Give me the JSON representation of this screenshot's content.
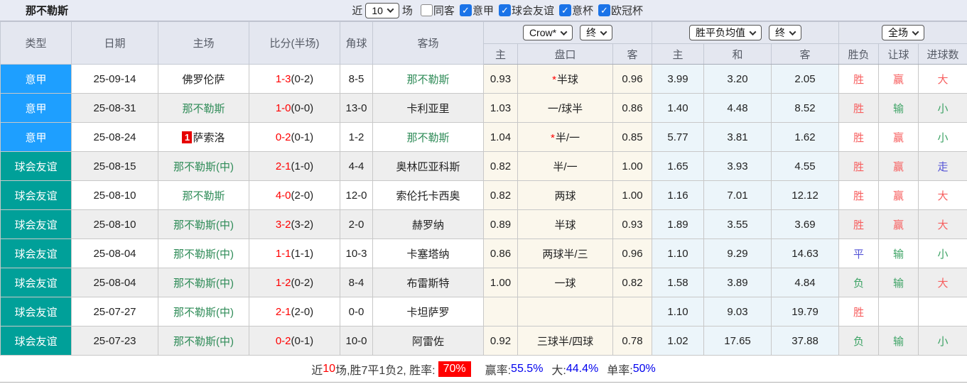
{
  "icons": {
    "check": "✓"
  },
  "top_bar": {
    "title": "那不勒斯",
    "recent_label": "近",
    "recent_count": "10",
    "matches_label": "场",
    "same_away_label": "同客",
    "filters": [
      {
        "label": "意甲",
        "checked": true
      },
      {
        "label": "球会友谊",
        "checked": true
      },
      {
        "label": "意杯",
        "checked": true
      },
      {
        "label": "欧冠杯",
        "checked": true
      }
    ]
  },
  "table": {
    "headers": {
      "type": "类型",
      "date": "日期",
      "home": "主场",
      "score": "比分(半场)",
      "corners": "角球",
      "away": "客场",
      "group_crow": {
        "bookmaker_select": "Crow*",
        "period_select": "终",
        "cols": [
          "主",
          "盘口",
          "客"
        ]
      },
      "group_mean": {
        "name_select": "胜平负均值",
        "period_select": "终",
        "cols": [
          "主",
          "和",
          "客"
        ]
      },
      "group_result": {
        "scope_select": "全场",
        "cols": [
          "胜负",
          "让球",
          "进球数"
        ]
      }
    },
    "rows": [
      {
        "type": "意甲",
        "league_class": "serie-a",
        "date": "25-09-14",
        "home": "佛罗伦萨",
        "home_color": "black",
        "home_rank": "",
        "score_ft": "1-3",
        "score_ht": "(0-2)",
        "corners": "8-5",
        "away": "那不勒斯",
        "away_color": "green",
        "crow_home": "0.93",
        "crow_ast": true,
        "crow_handicap": "半球",
        "crow_away": "0.96",
        "mean_home": "3.99",
        "mean_draw": "3.20",
        "mean_away": "2.05",
        "outcome": "胜",
        "outcome_color": "red",
        "handicap_result": "赢",
        "handicap_color": "red",
        "goals_result": "大",
        "goals_color": "red"
      },
      {
        "type": "意甲",
        "league_class": "serie-a",
        "date": "25-08-31",
        "home": "那不勒斯",
        "home_color": "green",
        "home_rank": "",
        "score_ft": "1-0",
        "score_ht": "(0-0)",
        "corners": "13-0",
        "away": "卡利亚里",
        "away_color": "black",
        "crow_home": "1.03",
        "crow_ast": false,
        "crow_handicap": "一/球半",
        "crow_away": "0.86",
        "mean_home": "1.40",
        "mean_draw": "4.48",
        "mean_away": "8.52",
        "outcome": "胜",
        "outcome_color": "red",
        "handicap_result": "输",
        "handicap_color": "green",
        "goals_result": "小",
        "goals_color": "green"
      },
      {
        "type": "意甲",
        "league_class": "serie-a",
        "date": "25-08-24",
        "home": "萨索洛",
        "home_color": "black",
        "home_rank": "1",
        "score_ft": "0-2",
        "score_ht": "(0-1)",
        "corners": "1-2",
        "away": "那不勒斯",
        "away_color": "green",
        "crow_home": "1.04",
        "crow_ast": true,
        "crow_handicap": "半/一",
        "crow_away": "0.85",
        "mean_home": "5.77",
        "mean_draw": "3.81",
        "mean_away": "1.62",
        "outcome": "胜",
        "outcome_color": "red",
        "handicap_result": "赢",
        "handicap_color": "red",
        "goals_result": "小",
        "goals_color": "green"
      },
      {
        "type": "球会友谊",
        "league_class": "friendly",
        "date": "25-08-15",
        "home": "那不勒斯(中)",
        "home_color": "green",
        "home_rank": "",
        "score_ft": "2-1",
        "score_ht": "(1-0)",
        "corners": "4-4",
        "away": "奥林匹亚科斯",
        "away_color": "black",
        "crow_home": "0.82",
        "crow_ast": false,
        "crow_handicap": "半/一",
        "crow_away": "1.00",
        "mean_home": "1.65",
        "mean_draw": "3.93",
        "mean_away": "4.55",
        "outcome": "胜",
        "outcome_color": "red",
        "handicap_result": "赢",
        "handicap_color": "red",
        "goals_result": "走",
        "goals_color": "blue"
      },
      {
        "type": "球会友谊",
        "league_class": "friendly",
        "date": "25-08-10",
        "home": "那不勒斯",
        "home_color": "green",
        "home_rank": "",
        "score_ft": "4-0",
        "score_ht": "(2-0)",
        "corners": "12-0",
        "away": "索伦托卡西奥",
        "away_color": "black",
        "crow_home": "0.82",
        "crow_ast": false,
        "crow_handicap": "两球",
        "crow_away": "1.00",
        "mean_home": "1.16",
        "mean_draw": "7.01",
        "mean_away": "12.12",
        "outcome": "胜",
        "outcome_color": "red",
        "handicap_result": "赢",
        "handicap_color": "red",
        "goals_result": "大",
        "goals_color": "red"
      },
      {
        "type": "球会友谊",
        "league_class": "friendly",
        "date": "25-08-10",
        "home": "那不勒斯(中)",
        "home_color": "green",
        "home_rank": "",
        "score_ft": "3-2",
        "score_ht": "(3-2)",
        "corners": "2-0",
        "away": "赫罗纳",
        "away_color": "black",
        "crow_home": "0.89",
        "crow_ast": false,
        "crow_handicap": "半球",
        "crow_away": "0.93",
        "mean_home": "1.89",
        "mean_draw": "3.55",
        "mean_away": "3.69",
        "outcome": "胜",
        "outcome_color": "red",
        "handicap_result": "赢",
        "handicap_color": "red",
        "goals_result": "大",
        "goals_color": "red"
      },
      {
        "type": "球会友谊",
        "league_class": "friendly",
        "date": "25-08-04",
        "home": "那不勒斯(中)",
        "home_color": "green",
        "home_rank": "",
        "score_ft": "1-1",
        "score_ht": "(1-1)",
        "corners": "10-3",
        "away": "卡塞塔纳",
        "away_color": "black",
        "crow_home": "0.86",
        "crow_ast": false,
        "crow_handicap": "两球半/三",
        "crow_away": "0.96",
        "mean_home": "1.10",
        "mean_draw": "9.29",
        "mean_away": "14.63",
        "outcome": "平",
        "outcome_color": "blue",
        "handicap_result": "输",
        "handicap_color": "green",
        "goals_result": "小",
        "goals_color": "green"
      },
      {
        "type": "球会友谊",
        "league_class": "friendly",
        "date": "25-08-04",
        "home": "那不勒斯(中)",
        "home_color": "green",
        "home_rank": "",
        "score_ft": "1-2",
        "score_ht": "(0-2)",
        "corners": "8-4",
        "away": "布雷斯特",
        "away_color": "black",
        "crow_home": "1.00",
        "crow_ast": false,
        "crow_handicap": "一球",
        "crow_away": "0.82",
        "mean_home": "1.58",
        "mean_draw": "3.89",
        "mean_away": "4.84",
        "outcome": "负",
        "outcome_color": "green",
        "handicap_result": "输",
        "handicap_color": "green",
        "goals_result": "大",
        "goals_color": "red"
      },
      {
        "type": "球会友谊",
        "league_class": "friendly",
        "date": "25-07-27",
        "home": "那不勒斯(中)",
        "home_color": "green",
        "home_rank": "",
        "score_ft": "2-1",
        "score_ht": "(2-0)",
        "corners": "0-0",
        "away": "卡坦萨罗",
        "away_color": "black",
        "crow_home": "",
        "crow_ast": false,
        "crow_handicap": "",
        "crow_away": "",
        "mean_home": "1.10",
        "mean_draw": "9.03",
        "mean_away": "19.79",
        "outcome": "胜",
        "outcome_color": "red",
        "handicap_result": "",
        "handicap_color": "none",
        "goals_result": "",
        "goals_color": "none"
      },
      {
        "type": "球会友谊",
        "league_class": "friendly",
        "date": "25-07-23",
        "home": "那不勒斯(中)",
        "home_color": "green",
        "home_rank": "",
        "score_ft": "0-2",
        "score_ht": "(0-1)",
        "corners": "10-0",
        "away": "阿雷佐",
        "away_color": "black",
        "crow_home": "0.92",
        "crow_ast": false,
        "crow_handicap": "三球半/四球",
        "crow_away": "0.78",
        "mean_home": "1.02",
        "mean_draw": "17.65",
        "mean_away": "37.88",
        "outcome": "负",
        "outcome_color": "green",
        "handicap_result": "输",
        "handicap_color": "green",
        "goals_result": "小",
        "goals_color": "green"
      }
    ]
  },
  "footer": {
    "recent_label": "近",
    "recent_count": "10",
    "summary_text": "场,胜7平1负2, 胜率:",
    "win_rate": "70%",
    "win_odds_label": "赢率:",
    "win_odds_value": "55.5%",
    "big_label": "大:",
    "big_value": "44.4%",
    "single_label": "单率:",
    "single_value": "50%"
  }
}
